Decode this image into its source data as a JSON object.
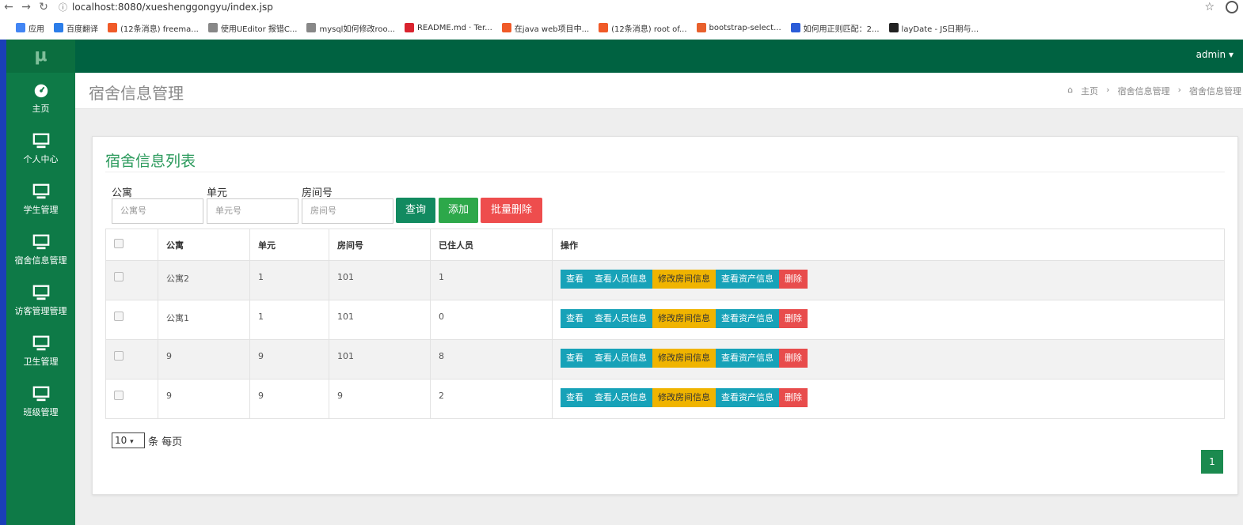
{
  "browser": {
    "url": "localhost:8080/xueshenggongyu/index.jsp",
    "bookmarks": [
      {
        "label": "应用",
        "color": "#4285f4"
      },
      {
        "label": "百度翻译",
        "color": "#2b7de9"
      },
      {
        "label": "(12条消息) freema...",
        "color": "#f05a28"
      },
      {
        "label": "使用UEditor 报错C...",
        "color": "#555555"
      },
      {
        "label": "mysql如何修改roo...",
        "color": "#555555"
      },
      {
        "label": "README.md · Ter...",
        "color": "#d9232e"
      },
      {
        "label": "在java web项目中...",
        "color": "#f05a28"
      },
      {
        "label": "(12条消息) root of...",
        "color": "#f05a28"
      },
      {
        "label": "bootstrap-select...",
        "color": "#e8602c"
      },
      {
        "label": "如何用正则匹配：2...",
        "color": "#2b5cd8"
      },
      {
        "label": "layDate - JS日期与...",
        "color": "#222222"
      }
    ]
  },
  "sidebar": {
    "logo": "μ",
    "items": [
      {
        "label": "主页",
        "icon": "dashboard-icon"
      },
      {
        "label": "个人中心",
        "icon": "monitor-icon"
      },
      {
        "label": "学生管理",
        "icon": "monitor-icon"
      },
      {
        "label": "宿舍信息管理",
        "icon": "monitor-icon"
      },
      {
        "label": "访客管理管理",
        "icon": "monitor-icon"
      },
      {
        "label": "卫生管理",
        "icon": "monitor-icon"
      },
      {
        "label": "班级管理",
        "icon": "monitor-icon"
      }
    ]
  },
  "topbar": {
    "user": "admin ▾"
  },
  "header": {
    "title": "宿舍信息管理",
    "breadcrumbs": [
      "主页",
      "宿舍信息管理",
      "宿舍信息管理"
    ]
  },
  "panel": {
    "title": "宿舍信息列表",
    "filters": [
      {
        "label": "公寓",
        "placeholder": "公寓号"
      },
      {
        "label": "单元",
        "placeholder": "单元号"
      },
      {
        "label": "房间号",
        "placeholder": "房间号"
      }
    ],
    "buttons": {
      "query": "查询",
      "add": "添加",
      "batch_delete": "批量删除"
    },
    "columns": [
      "公寓",
      "单元",
      "房间号",
      "已住人员",
      "操作"
    ],
    "row_actions": [
      "查看",
      "查看人员信息",
      "修改房间信息",
      "查看资产信息",
      "删除"
    ],
    "rows": [
      [
        "公寓2",
        "1",
        "101",
        "1"
      ],
      [
        "公寓1",
        "1",
        "101",
        "0"
      ],
      [
        "9",
        "9",
        "101",
        "8"
      ],
      [
        "9",
        "9",
        "9",
        "2"
      ]
    ],
    "page_size": "10",
    "page_size_suffix": "条 每页",
    "current_page": "1"
  },
  "colors": {
    "sidebar": "#0e7a47",
    "topbar": "#006241",
    "accent": "#2b9a5c",
    "info": "#17a2b8",
    "warning": "#f0b400",
    "danger": "#e84c4c"
  }
}
